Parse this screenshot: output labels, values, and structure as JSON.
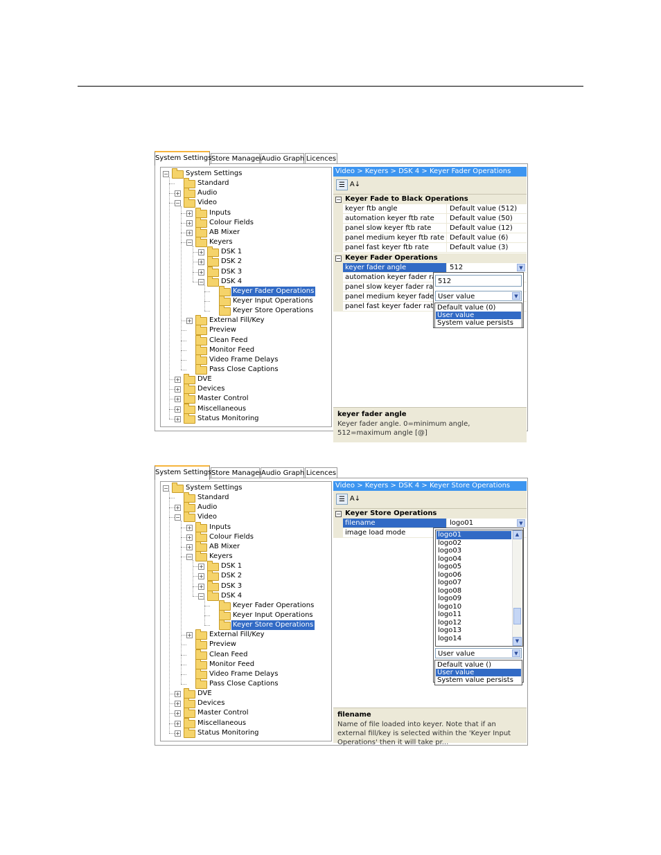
{
  "tabs": [
    "System Settings",
    "Store Manager",
    "Audio Graph",
    "Licences"
  ],
  "tree": {
    "root": "System Settings",
    "standard": "Standard",
    "audio": "Audio",
    "video": "Video",
    "inputs": "Inputs",
    "colour_fields": "Colour Fields",
    "ab_mixer": "AB Mixer",
    "keyers": "Keyers",
    "dsk1": "DSK 1",
    "dsk2": "DSK 2",
    "dsk3": "DSK 3",
    "dsk4": "DSK 4",
    "keyer_fader_operations": "Keyer Fader Operations",
    "keyer_input_operations": "Keyer Input Operations",
    "keyer_store_operations": "Keyer Store Operations",
    "external_fill_key": "External Fill/Key",
    "preview": "Preview",
    "clean_feed": "Clean Feed",
    "monitor_feed": "Monitor Feed",
    "video_frame_delays": "Video Frame Delays",
    "pass_close_captions": "Pass Close Captions",
    "dve": "DVE",
    "devices": "Devices",
    "master_control": "Master Control",
    "miscellaneous": "Miscellaneous",
    "status_monitoring": "Status Monitoring"
  },
  "panel1": {
    "breadcrumb": "Video > Keyers > DSK 4 > Keyer Fader Operations",
    "cat1": "Keyer Fade to Black Operations",
    "cat1_rows": [
      {
        "name": "keyer ftb angle",
        "value": "Default value (512)"
      },
      {
        "name": "automation keyer ftb rate",
        "value": "Default value (50)"
      },
      {
        "name": "panel slow keyer ftb rate",
        "value": "Default value (12)"
      },
      {
        "name": "panel medium keyer ftb rate",
        "value": "Default value (6)"
      },
      {
        "name": "panel fast keyer ftb rate",
        "value": "Default value (3)"
      }
    ],
    "cat2": "Keyer Fader Operations",
    "cat2_rows": [
      {
        "name": "keyer fader angle",
        "value": "512"
      },
      {
        "name": "automation keyer fader rate",
        "value": ""
      },
      {
        "name": "panel slow keyer fader rate",
        "value": ""
      },
      {
        "name": "panel medium keyer fader rate",
        "value": ""
      },
      {
        "name": "panel fast keyer fader rate",
        "value": ""
      }
    ],
    "editor_value": "512",
    "mode_value": "User value",
    "mode_options": [
      "Default value (0)",
      "User value",
      "System value persists"
    ],
    "desc_title": "keyer fader angle",
    "desc_text": "Keyer fader angle. 0=minimum angle, 512=maximum angle [@]"
  },
  "panel2": {
    "breadcrumb": "Video > Keyers > DSK 4 > Keyer Store Operations",
    "cat1": "Keyer Store Operations",
    "rows": [
      {
        "name": "filename",
        "value": "logo01"
      },
      {
        "name": "image load mode",
        "value": ""
      }
    ],
    "file_list": [
      "logo01",
      "logo02",
      "logo03",
      "logo04",
      "logo05",
      "logo06",
      "logo07",
      "logo08",
      "logo09",
      "logo10",
      "logo11",
      "logo12",
      "logo13",
      "logo14"
    ],
    "mode_value": "User value",
    "mode_options": [
      "Default value ()",
      "User value",
      "System value persists"
    ],
    "desc_title": "filename",
    "desc_text": "Name of file loaded into keyer. Note that if an external fill/key is selected within the 'Keyer Input Operations' then it will take pr..."
  }
}
